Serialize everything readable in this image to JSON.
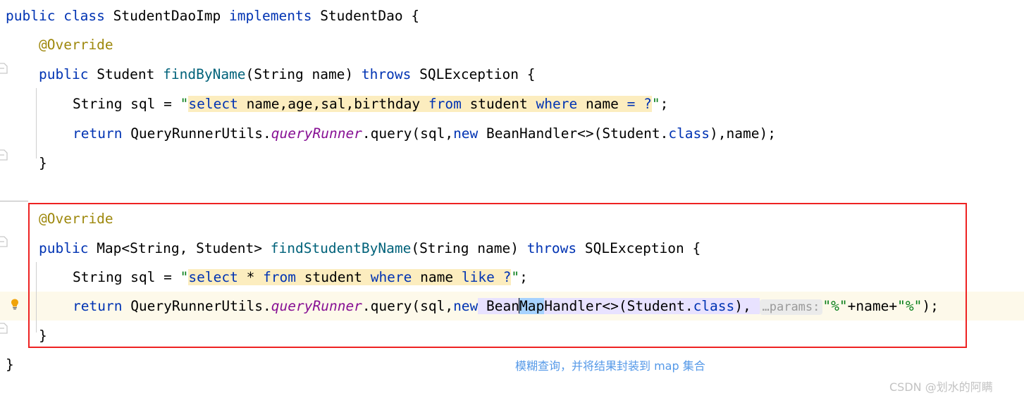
{
  "editor": {
    "language": "java",
    "background": "#ffffff",
    "current_line_color": "#fdf9ea",
    "annotation_box_color": "#ee2222"
  },
  "gutter": {
    "icons": [
      {
        "name": "implementing-method-marker",
        "row": 2
      },
      {
        "name": "implementing-method-marker",
        "row": 5
      },
      {
        "name": "implementing-method-marker",
        "row": 9
      },
      {
        "name": "intention-bulb",
        "row": 11
      }
    ]
  },
  "code": {
    "line1": {
      "kw_public": "public",
      "kw_class": "class",
      "type_name": "StudentDaoImp",
      "kw_implements": "implements",
      "iface_name": "StudentDao",
      "brace": "{"
    },
    "line2": {
      "annotation": "@Override"
    },
    "line3": {
      "kw_public": "public",
      "return_type": "Student",
      "method_name": "findByName",
      "params": "(String name)",
      "kw_throws": "throws",
      "exception": "SQLException",
      "brace": "{"
    },
    "line4": {
      "decl": "String sql = ",
      "quote_open": "\"",
      "sql_select": "select",
      "sql_cols": " name,age,sal,birthday ",
      "sql_from": "from",
      "sql_table": " student ",
      "sql_where": "where",
      "sql_col": " name ",
      "sql_eq": "= ?",
      "quote_close": "\"",
      "semi": ";"
    },
    "line5": {
      "kw_return": "return",
      "class_ref": " QueryRunnerUtils.",
      "static_field": "queryRunner",
      "call": ".query(sql,",
      "kw_new": "new",
      "handler": " BeanHandler<>(Student.",
      "kw_class": "class",
      "tail": "),name);"
    },
    "line6": {
      "brace": "}"
    },
    "line7": {
      "annotation": "@Override"
    },
    "line8": {
      "kw_public": "public",
      "return_type": " Map<String, Student> ",
      "method_name": "findStudentByName",
      "params": "(String name) ",
      "kw_throws": "throws",
      "exception": " SQLException ",
      "brace": "{"
    },
    "line9": {
      "decl": "String sql = ",
      "quote_open": "\"",
      "sql_select": "select",
      "sql_star": " * ",
      "sql_from": "from",
      "sql_table": " student ",
      "sql_where": "where",
      "sql_col": " name ",
      "sql_like": "like",
      "sql_param": " ?",
      "quote_close": "\"",
      "semi": ";"
    },
    "line10": {
      "kw_return": "return",
      "class_ref": " QueryRunnerUtils.",
      "static_field": "queryRunner",
      "call": ".query(sql,",
      "kw_new": "new",
      "handler_pre": " Bean",
      "handler_sel": "Map",
      "handler_post": "Handler<>(Student.",
      "kw_class": "class",
      "after_class": "), ",
      "inlay_hint": "…params:",
      "str_pct_open": "\"%\"",
      "plus1": "+",
      "var_name": "name",
      "plus2": "+",
      "str_pct_close": "\"%\"",
      "tail": ");"
    },
    "line11": {
      "brace": "}"
    },
    "line12": {
      "brace": "}"
    }
  },
  "annotation": {
    "note_text": "模糊查询，并将结果封装到 map 集合",
    "note_color": "#5599e8"
  },
  "watermark": {
    "text": "CSDN @划水的阿瞒"
  }
}
